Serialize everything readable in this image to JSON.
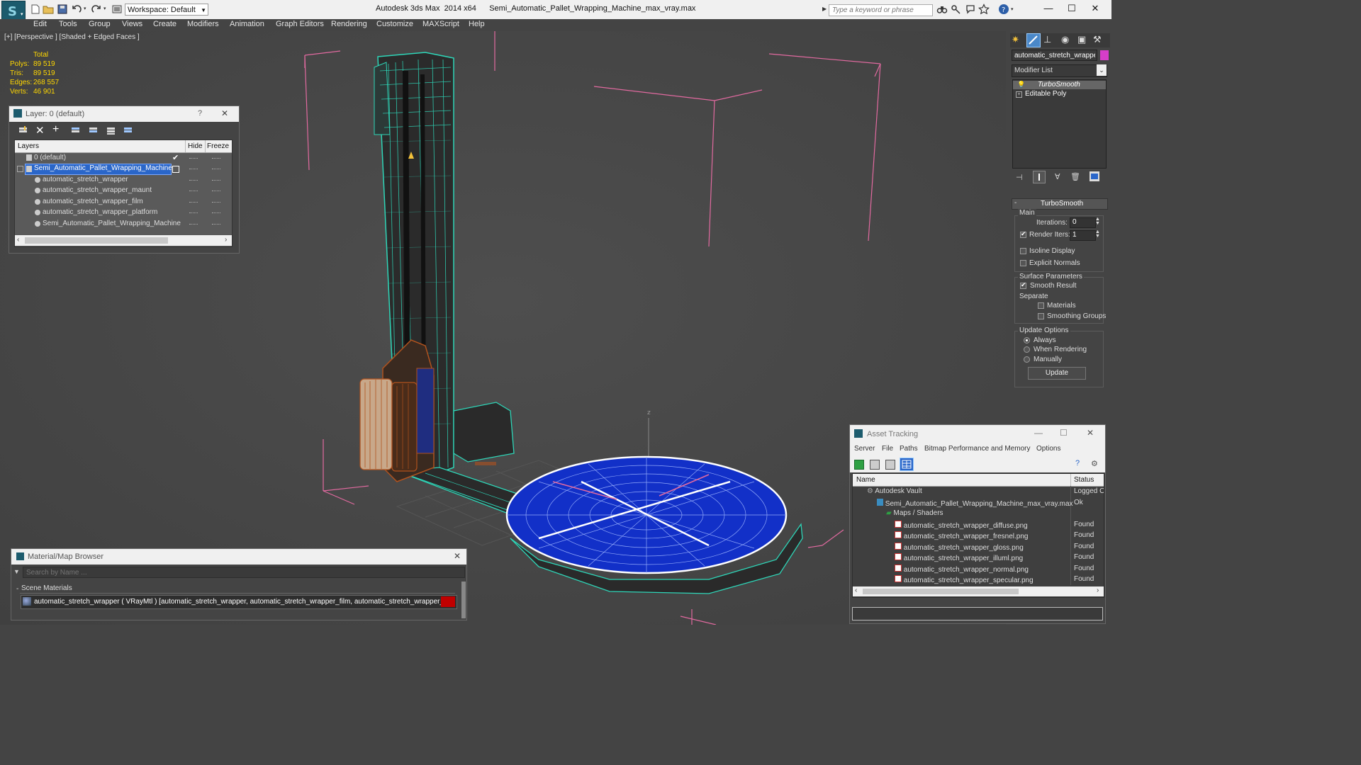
{
  "app": {
    "title": "Autodesk 3ds Max  2014 x64      Semi_Automatic_Pallet_Wrapping_Machine_max_vray.max",
    "workspace_label": "Workspace: Default",
    "search_placeholder": "Type a keyword or phrase"
  },
  "menu": [
    "Edit",
    "Tools",
    "Group",
    "Views",
    "Create",
    "Modifiers",
    "Animation",
    "Graph Editors",
    "Rendering",
    "Customize",
    "MAXScript",
    "Help"
  ],
  "viewport": {
    "label": "[+] [Perspective ] [Shaded + Edged Faces ]",
    "stats": {
      "header": "Total",
      "rows": [
        {
          "label": "Polys:",
          "value": "89 519"
        },
        {
          "label": "Tris:",
          "value": "89 519"
        },
        {
          "label": "Edges:",
          "value": "268 557"
        },
        {
          "label": "Verts:",
          "value": "46 901"
        }
      ]
    },
    "axis_z": "z"
  },
  "layer_panel": {
    "title": "Layer: 0 (default)",
    "help": "?",
    "close": "✕",
    "columns": [
      "Layers",
      "Hide",
      "Freeze"
    ],
    "rows": [
      {
        "name": "0 (default)",
        "check": "✔"
      },
      {
        "name": "Semi_Automatic_Pallet_Wrapping_Machine",
        "selected": true
      },
      {
        "name": "automatic_stretch_wrapper"
      },
      {
        "name": "automatic_stretch_wrapper_maunt"
      },
      {
        "name": "automatic_stretch_wrapper_film"
      },
      {
        "name": "automatic_stretch_wrapper_platform"
      },
      {
        "name": "Semi_Automatic_Pallet_Wrapping_Machine"
      }
    ]
  },
  "material_browser": {
    "title": "Material/Map Browser",
    "close": "✕",
    "search_placeholder": "Search by Name ...",
    "section": "Scene Materials",
    "item": "automatic_stretch_wrapper  ( VRayMtl ) [automatic_stretch_wrapper, automatic_stretch_wrapper_film, automatic_stretch_wrapper_maunt, au..."
  },
  "command_panel": {
    "object_name": "automatic_stretch_wrapper_p",
    "modifier_list": "Modifier List",
    "stack": [
      "TurboSmooth",
      "Editable Poly"
    ],
    "rollout_title": "TurboSmooth",
    "main_group": "Main",
    "iterations_label": "Iterations:",
    "iterations_value": "0",
    "render_iters_label": "Render Iters:",
    "render_iters_value": "1",
    "isoline_display": "Isoline Display",
    "explicit_normals": "Explicit Normals",
    "surface_params": "Surface Parameters",
    "smooth_result": "Smooth Result",
    "separate": "Separate",
    "materials": "Materials",
    "smoothing_groups": "Smoothing Groups",
    "update_options": "Update Options",
    "always": "Always",
    "when_rendering": "When Rendering",
    "manually": "Manually",
    "update_button": "Update",
    "accent_color": "#d63ec9"
  },
  "asset_tracking": {
    "title": "Asset Tracking",
    "menu": [
      "Server",
      "File",
      "Paths",
      "Bitmap Performance and Memory",
      "Options"
    ],
    "columns": [
      "Name",
      "Status"
    ],
    "rows": [
      {
        "name": "Autodesk Vault",
        "status": "Logged O"
      },
      {
        "name": "Semi_Automatic_Pallet_Wrapping_Machine_max_vray.max",
        "status": "Ok"
      },
      {
        "name": "Maps / Shaders",
        "status": ""
      },
      {
        "name": "automatic_stretch_wrapper_diffuse.png",
        "status": "Found"
      },
      {
        "name": "automatic_stretch_wrapper_fresnel.png",
        "status": "Found"
      },
      {
        "name": "automatic_stretch_wrapper_gloss.png",
        "status": "Found"
      },
      {
        "name": "automatic_stretch_wrapper_illuml.png",
        "status": "Found"
      },
      {
        "name": "automatic_stretch_wrapper_normal.png",
        "status": "Found"
      },
      {
        "name": "automatic_stretch_wrapper_specular.png",
        "status": "Found"
      }
    ]
  },
  "colors": {
    "selection_blue": "#2a66c9",
    "wire_teal": "#2ed6b8",
    "platform_blue": "#1230c8",
    "film_orange": "#b0521e",
    "bounding_pink": "#e26aa0"
  }
}
